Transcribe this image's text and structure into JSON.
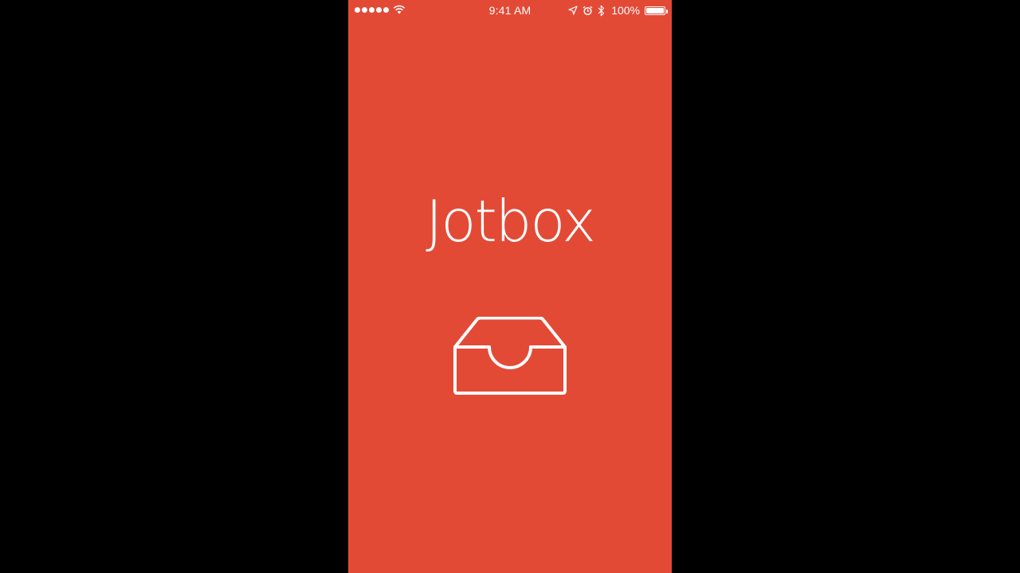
{
  "status_bar": {
    "signal_dots": 5,
    "time": "9:41 AM",
    "battery_percent": "100%",
    "battery_level": 1.0,
    "icons": [
      "signal-dots-icon",
      "wifi-icon",
      "location-arrow-icon",
      "alarm-clock-icon",
      "bluetooth-icon",
      "battery-icon"
    ]
  },
  "splash": {
    "app_name": "Jotbox",
    "logo_icon": "inbox-tray-icon"
  },
  "colors": {
    "background": "#e34a36",
    "foreground": "#ffffff",
    "letterbox": "#000000"
  }
}
